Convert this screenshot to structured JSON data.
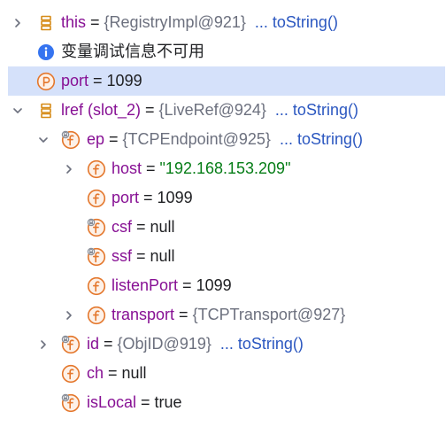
{
  "colors": {
    "selection": "#d5e1fa",
    "field_icon": "#e4772c",
    "slot_icon": "#d68b18",
    "info_icon": "#3574f0",
    "string_value": "#067d17",
    "link": "#2b57c0",
    "object_ref": "#6c707e"
  },
  "rows": [
    {
      "chevron": "right",
      "icon": "slot-icon",
      "name": "this",
      "eq": " = ",
      "object": "{RegistryImpl@921}",
      "action": "... toString()"
    },
    {
      "icon": "info-icon",
      "message": "变量调试信息不可用"
    },
    {
      "icon": "parameter-icon",
      "name": "port",
      "eq": " = ",
      "value": "1099",
      "selected": true
    },
    {
      "chevron": "down",
      "icon": "slot-icon",
      "name": "lref (slot_2)",
      "eq": " = ",
      "object": "{LiveRef@924}",
      "action": "... toString()"
    },
    {
      "chevron": "down",
      "icon": "final-field-icon",
      "name": "ep",
      "eq": " = ",
      "object": "{TCPEndpoint@925}",
      "action": "... toString()"
    },
    {
      "chevron": "right",
      "icon": "field-icon",
      "name": "host",
      "eq": " = ",
      "string": "\"192.168.153.209\""
    },
    {
      "icon": "field-icon",
      "name": "port",
      "eq": " = ",
      "value": "1099"
    },
    {
      "icon": "final-field-icon",
      "name": "csf",
      "eq": " = ",
      "value": "null"
    },
    {
      "icon": "final-field-icon",
      "name": "ssf",
      "eq": " = ",
      "value": "null"
    },
    {
      "icon": "field-icon",
      "name": "listenPort",
      "eq": " = ",
      "value": "1099"
    },
    {
      "chevron": "right",
      "icon": "field-icon",
      "name": "transport",
      "eq": " = ",
      "object": "{TCPTransport@927}"
    },
    {
      "chevron": "right",
      "icon": "final-field-icon",
      "name": "id",
      "eq": " = ",
      "object": "{ObjID@919}",
      "action": "... toString()"
    },
    {
      "icon": "field-icon",
      "name": "ch",
      "eq": " = ",
      "value": "null"
    },
    {
      "icon": "final-field-icon",
      "name": "isLocal",
      "eq": " = ",
      "value": "true"
    }
  ]
}
